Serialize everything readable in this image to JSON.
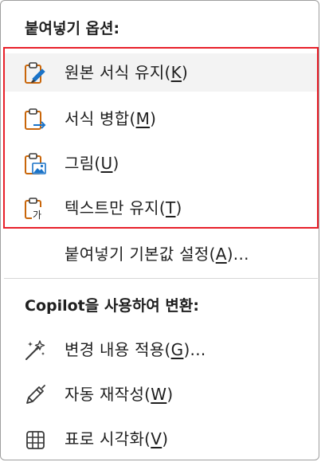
{
  "paste_options": {
    "header": "붙여넣기 옵션:",
    "items": [
      {
        "text": "원본 서식 유지(",
        "key": "K",
        "close": ")",
        "icon": "paste-keep-source-icon"
      },
      {
        "text": "서식 병합(",
        "key": "M",
        "close": ")",
        "icon": "paste-merge-formatting-icon"
      },
      {
        "text": "그림(",
        "key": "U",
        "close": ")",
        "icon": "paste-picture-icon"
      },
      {
        "text": "텍스트만 유지(",
        "key": "T",
        "close": ")",
        "icon": "paste-text-only-icon"
      }
    ],
    "set_default": {
      "text": "붙여넣기 기본값 설정(",
      "key": "A",
      "close": ")..."
    }
  },
  "copilot": {
    "header": "Copilot을 사용하여 변환:",
    "items": [
      {
        "text": "변경 내용 적용(",
        "key": "G",
        "close": ")...",
        "icon": "sparkle-icon"
      },
      {
        "text": "자동 재작성(",
        "key": "W",
        "close": ")",
        "icon": "pen-icon"
      },
      {
        "text": "표로 시각화(",
        "key": "V",
        "close": ")",
        "icon": "table-icon"
      }
    ]
  },
  "paste_icon_text_glyph": "가",
  "colors": {
    "clipboard_orange": "#c9660a",
    "accent_blue": "#1a73c8",
    "highlight_red": "#e8202a"
  }
}
